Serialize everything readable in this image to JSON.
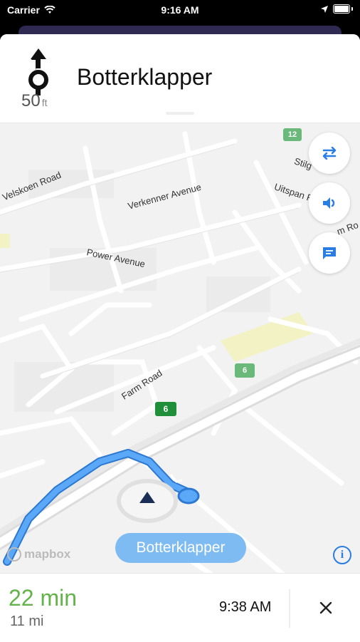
{
  "status_bar": {
    "carrier": "Carrier",
    "time": "9:16 AM"
  },
  "banner": {
    "street": "Botterklapper",
    "distance_value": "50",
    "distance_unit": "ft",
    "maneuver_icon": "roundabout-icon"
  },
  "map": {
    "roads": {
      "velskoen": "Velskoen Road",
      "verkenner": "Verkenner Avenue",
      "uitspan": "Uitspan R",
      "stilg": "Stilg",
      "power": "Power Avenue",
      "farm": "Farm Road",
      "m_ro": "m Ro"
    },
    "shields": {
      "shield_12": "12",
      "shield_6a": "6",
      "shield_6b": "6"
    },
    "destination_label": "Botterklapper",
    "attribution": "mapbox"
  },
  "buttons": {
    "route_overview_icon": "swap-arrows-icon",
    "mute_icon": "speaker-icon",
    "feedback_icon": "chat-icon",
    "info_icon": "info-icon",
    "close_icon": "close-icon"
  },
  "bottom": {
    "eta": "22 min",
    "distance": "11 mi",
    "arrival_time": "9:38 AM"
  },
  "colors": {
    "route": "#4a9cf5",
    "eta_green": "#63b34a",
    "shield_green": "#1f8f3a",
    "accent_blue": "#2a7de1",
    "pill_blue": "#7dbbf2"
  }
}
